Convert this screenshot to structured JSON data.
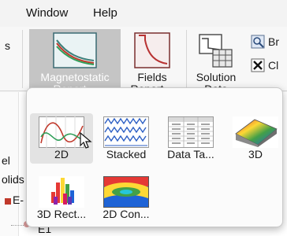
{
  "menubar": {
    "items": [
      {
        "label": "Window"
      },
      {
        "label": "Help"
      }
    ]
  },
  "ribbon": {
    "magnetostatic_report": {
      "line1": "Magnetostatic",
      "line2": "Report"
    },
    "fields_report": {
      "line1": "Fields",
      "line2": "Report"
    },
    "solution_data": {
      "line1": "Solution",
      "line2": "Data"
    },
    "br_button": "Br",
    "cl_button": "Cl",
    "left_fragment": "s"
  },
  "tree": {
    "frag1": "el",
    "frag2": "olids",
    "frag3": "E-",
    "frag4": "E1"
  },
  "gallery": {
    "items": [
      {
        "label": "2D",
        "icon": "2d-report-icon"
      },
      {
        "label": "Stacked",
        "icon": "stacked-report-icon"
      },
      {
        "label": "Data Ta...",
        "icon": "data-table-icon"
      },
      {
        "label": "3D",
        "icon": "3d-report-icon"
      },
      {
        "label": "3D Rect...",
        "icon": "3d-rectangular-icon"
      },
      {
        "label": "2D Con...",
        "icon": "2d-contour-icon"
      }
    ]
  },
  "colors": {
    "active_bg": "#c5c5c5",
    "popup_bg": "#fbfbfb",
    "hover_bg": "#e3e3e3"
  }
}
